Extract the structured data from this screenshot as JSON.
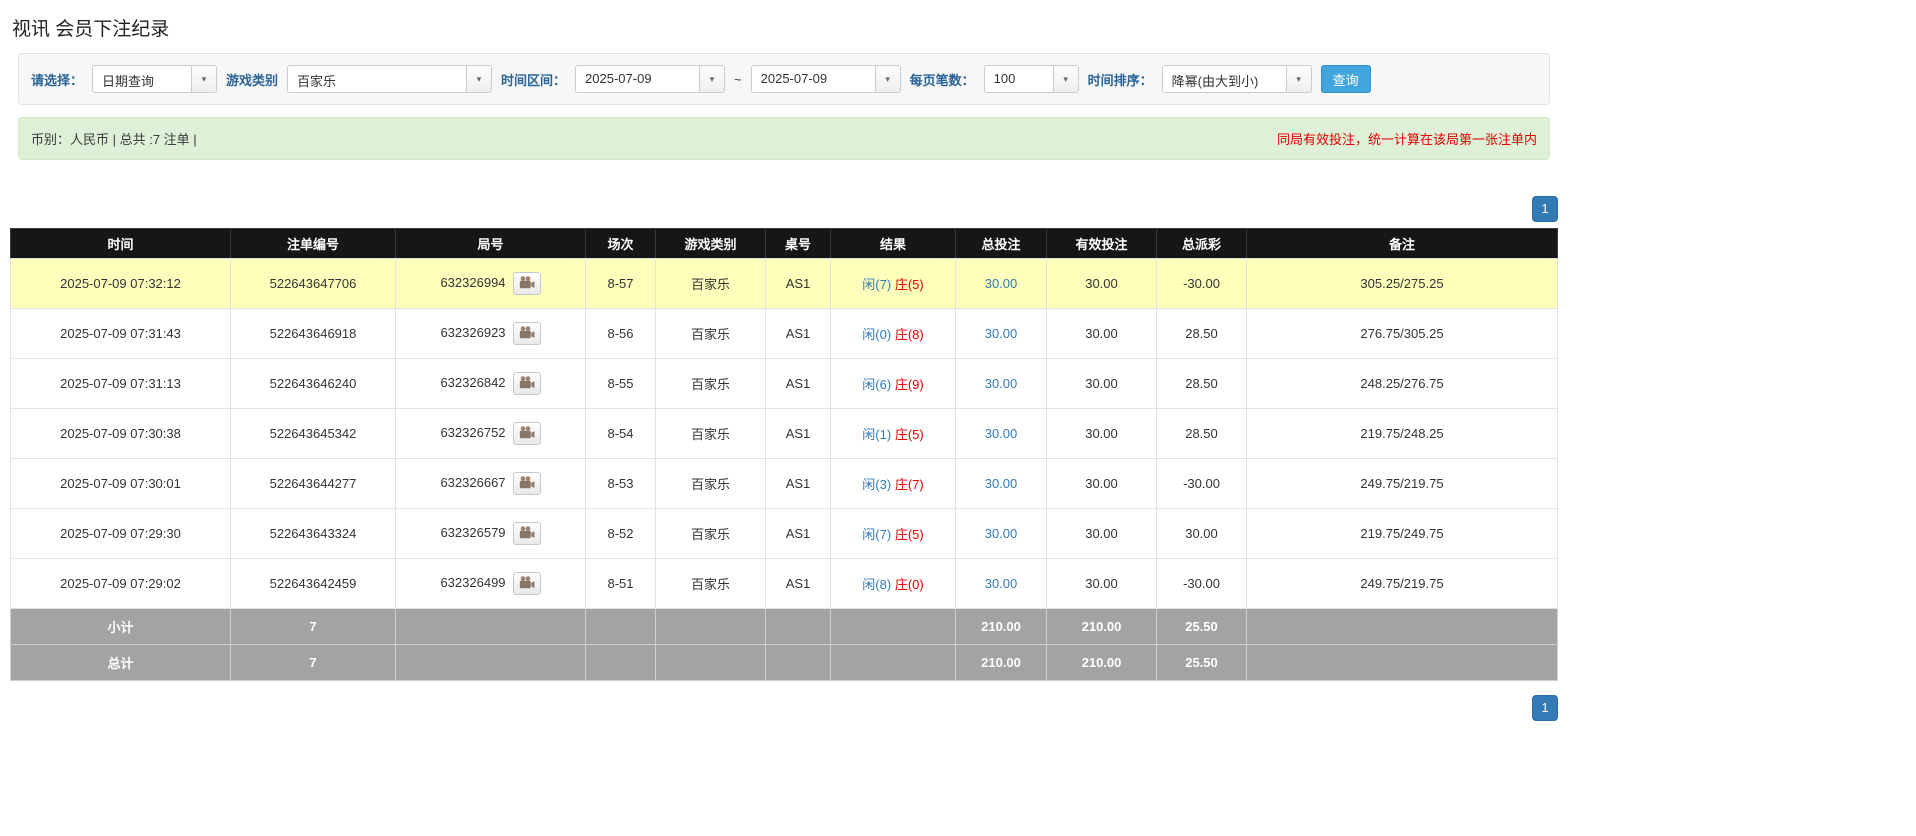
{
  "title": "视讯 会员下注纪录",
  "filters": {
    "select_label": "请选择：",
    "select_value": "日期查询",
    "game_label": "游戏类别",
    "game_value": "百家乐",
    "range_label": "时间区间：",
    "date_from": "2025-07-09",
    "range_sep": "~",
    "date_to": "2025-07-09",
    "per_page_label": "每页笔数：",
    "per_page_value": "100",
    "sort_label": "时间排序：",
    "sort_value": "降幂(由大到小)",
    "search_label": "查询"
  },
  "summary": {
    "currency_info": "币别：人民币 | 总共 :7 注单 |",
    "notice": "同局有效投注，统一计算在该局第一张注单内"
  },
  "pagination": {
    "current_page": "1"
  },
  "table": {
    "headers": [
      "时间",
      "注单编号",
      "局号",
      "场次",
      "游戏类别",
      "桌号",
      "结果",
      "总投注",
      "有效投注",
      "总派彩",
      "备注"
    ],
    "rows": [
      {
        "time": "2025-07-09 07:32:12",
        "bet_no": "522643647706",
        "round_no": "632326994",
        "session": "8-57",
        "game": "百家乐",
        "table_no": "AS1",
        "player": "闲(7)",
        "banker": "庄(5)",
        "total_bet": "30.00",
        "valid_bet": "30.00",
        "payout": "-30.00",
        "note": "305.25/275.25",
        "highlight": true
      },
      {
        "time": "2025-07-09 07:31:43",
        "bet_no": "522643646918",
        "round_no": "632326923",
        "session": "8-56",
        "game": "百家乐",
        "table_no": "AS1",
        "player": "闲(0)",
        "banker": "庄(8)",
        "total_bet": "30.00",
        "valid_bet": "30.00",
        "payout": "28.50",
        "note": "276.75/305.25",
        "highlight": false
      },
      {
        "time": "2025-07-09 07:31:13",
        "bet_no": "522643646240",
        "round_no": "632326842",
        "session": "8-55",
        "game": "百家乐",
        "table_no": "AS1",
        "player": "闲(6)",
        "banker": "庄(9)",
        "total_bet": "30.00",
        "valid_bet": "30.00",
        "payout": "28.50",
        "note": "248.25/276.75",
        "highlight": false
      },
      {
        "time": "2025-07-09 07:30:38",
        "bet_no": "522643645342",
        "round_no": "632326752",
        "session": "8-54",
        "game": "百家乐",
        "table_no": "AS1",
        "player": "闲(1)",
        "banker": "庄(5)",
        "total_bet": "30.00",
        "valid_bet": "30.00",
        "payout": "28.50",
        "note": "219.75/248.25",
        "highlight": false
      },
      {
        "time": "2025-07-09 07:30:01",
        "bet_no": "522643644277",
        "round_no": "632326667",
        "session": "8-53",
        "game": "百家乐",
        "table_no": "AS1",
        "player": "闲(3)",
        "banker": "庄(7)",
        "total_bet": "30.00",
        "valid_bet": "30.00",
        "payout": "-30.00",
        "note": "249.75/219.75",
        "highlight": false
      },
      {
        "time": "2025-07-09 07:29:30",
        "bet_no": "522643643324",
        "round_no": "632326579",
        "session": "8-52",
        "game": "百家乐",
        "table_no": "AS1",
        "player": "闲(7)",
        "banker": "庄(5)",
        "total_bet": "30.00",
        "valid_bet": "30.00",
        "payout": "30.00",
        "note": "219.75/249.75",
        "highlight": false
      },
      {
        "time": "2025-07-09 07:29:02",
        "bet_no": "522643642459",
        "round_no": "632326499",
        "session": "8-51",
        "game": "百家乐",
        "table_no": "AS1",
        "player": "闲(8)",
        "banker": "庄(0)",
        "total_bet": "30.00",
        "valid_bet": "30.00",
        "payout": "-30.00",
        "note": "249.75/219.75",
        "highlight": false
      }
    ],
    "subtotal": {
      "label": "小计",
      "count": "7",
      "total_bet": "210.00",
      "valid_bet": "210.00",
      "payout": "25.50"
    },
    "grand_total": {
      "label": "总计",
      "count": "7",
      "total_bet": "210.00",
      "valid_bet": "210.00",
      "payout": "25.50"
    }
  },
  "colors": {
    "accent_blue": "#337ab7",
    "value_blue": "#337ab7",
    "player_blue": "#337ab7",
    "banker_red": "#e60000",
    "negative_red": "#ff0000",
    "highlight_yellow": "#ffffbc",
    "summary_green": "#dff0d8",
    "header_black": "#161616",
    "footer_gray": "#a3a3a3"
  }
}
